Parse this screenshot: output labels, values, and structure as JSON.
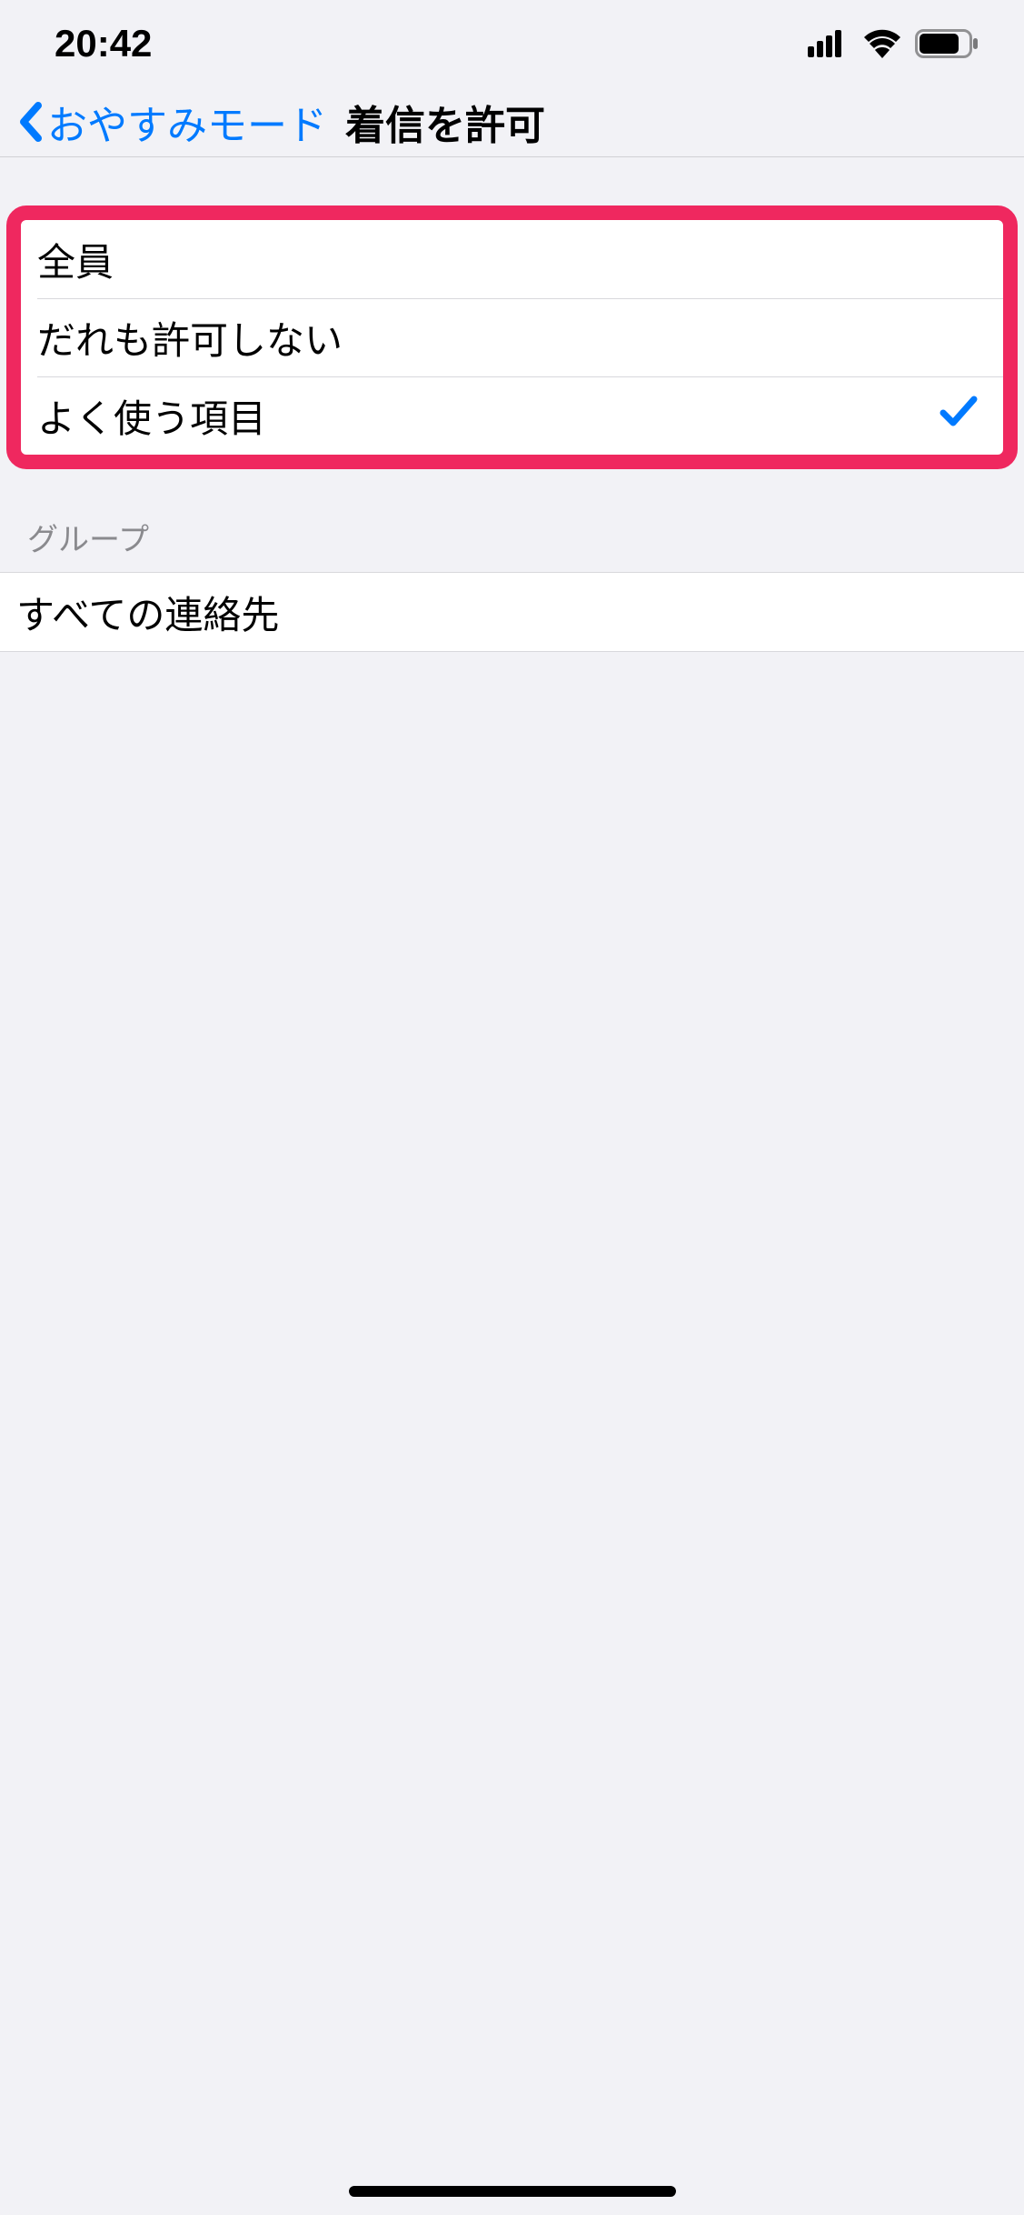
{
  "status": {
    "time": "20:42"
  },
  "nav": {
    "back_label": "おやすみモード",
    "title": "着信を許可"
  },
  "allow_calls": {
    "items": [
      {
        "label": "全員",
        "selected": false
      },
      {
        "label": "だれも許可しない",
        "selected": false
      },
      {
        "label": "よく使う項目",
        "selected": true
      }
    ]
  },
  "group_section": {
    "header": "グループ",
    "items": [
      {
        "label": "すべての連絡先",
        "selected": false
      }
    ]
  }
}
